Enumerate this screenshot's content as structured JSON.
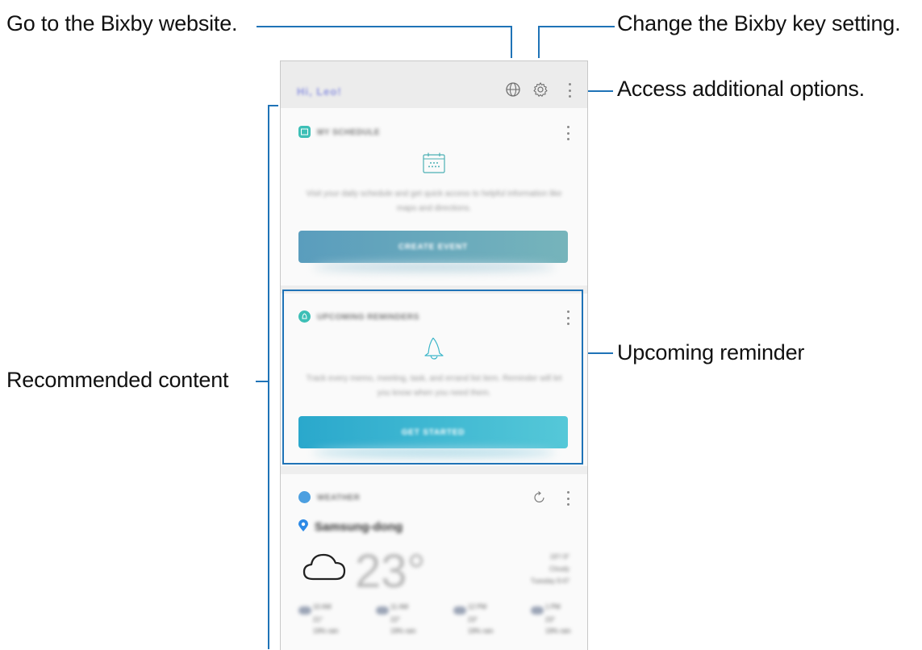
{
  "callouts": {
    "bixby_website": "Go to the Bixby website.",
    "bixby_key_setting": "Change the Bixby key setting.",
    "additional_options": "Access additional options.",
    "upcoming_reminder": "Upcoming reminder",
    "recommended_content": "Recommended content"
  },
  "app": {
    "logo_text": "Hi, Leo!",
    "icons": [
      "globe-icon",
      "gear-icon",
      "more-options-icon"
    ]
  },
  "cards": {
    "schedule": {
      "title": "MY SCHEDULE",
      "icon": "schedule-icon",
      "description": "Visit your daily schedule and get quick access to helpful information like maps and directions.",
      "button": "CREATE EVENT",
      "icon_color": "#3dbfb6"
    },
    "reminder": {
      "title": "UPCOMING REMINDERS",
      "icon": "bell-icon",
      "description": "Track every memo, meeting, task, and errand list item. Reminder will let you know when you need them.",
      "button": "GET STARTED",
      "icon_color": "#3dbfb6"
    },
    "weather": {
      "title": "WEATHER",
      "icon": "weather-icon",
      "location": "Samsung-dong",
      "temperature": "23°",
      "details": [
        "19°/ 9°",
        "Cloudy",
        "Tuesday 9:47"
      ],
      "forecast": [
        {
          "time": "10 AM",
          "temp": "21°",
          "status": "19% rain"
        },
        {
          "time": "11 AM",
          "temp": "22°",
          "status": "19% rain"
        },
        {
          "time": "12 PM",
          "temp": "23°",
          "status": "19% rain"
        },
        {
          "time": "1 PM",
          "temp": "23°",
          "status": "19% rain"
        }
      ]
    }
  },
  "colors": {
    "accent_line": "#1f73b7",
    "schedule_button": "#5b9fbd",
    "reminder_button": "#2fb4d4"
  }
}
